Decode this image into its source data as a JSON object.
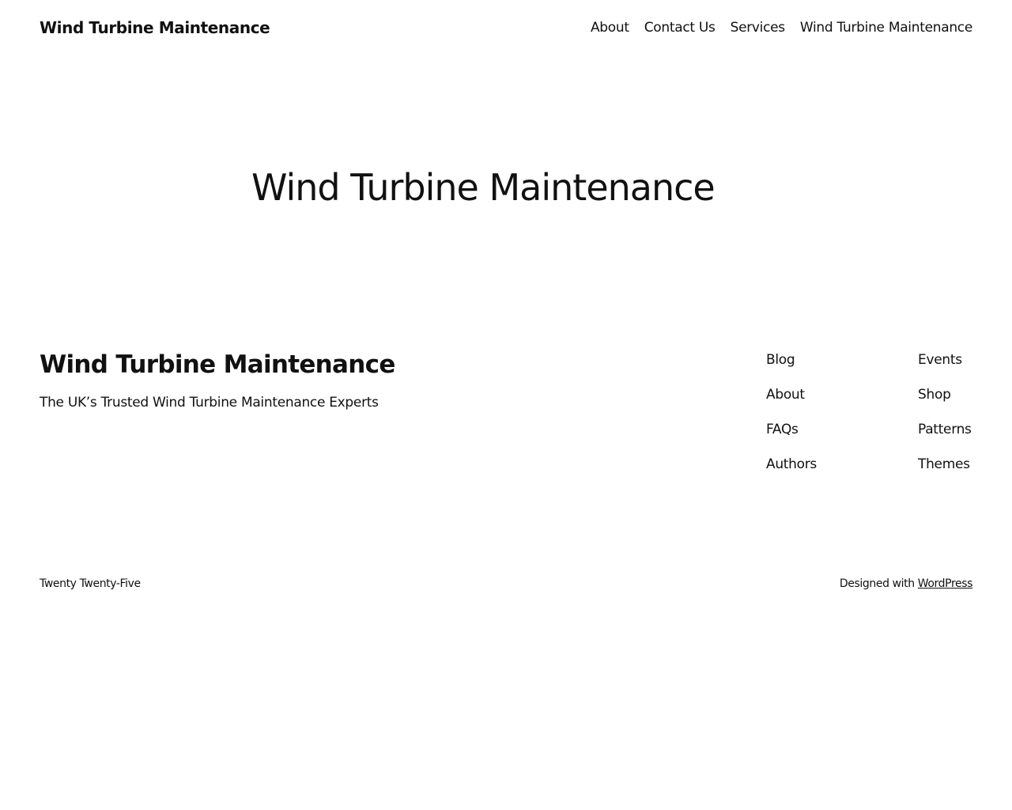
{
  "header": {
    "site_title": "Wind Turbine Maintenance",
    "nav": [
      "About",
      "Contact Us",
      "Services",
      "Wind Turbine Maintenance"
    ]
  },
  "hero": {
    "title": "Wind Turbine Maintenance"
  },
  "footer": {
    "title": "Wind Turbine Maintenance",
    "tagline": "The UK’s Trusted Wind Turbine Maintenance Experts",
    "nav_col_1": [
      "Blog",
      "About",
      "FAQs",
      "Authors"
    ],
    "nav_col_2": [
      "Events",
      "Shop",
      "Patterns",
      "Themes"
    ],
    "theme_credit": "Twenty Twenty-Five",
    "designed_with": "Designed with ",
    "wordpress": "WordPress"
  }
}
